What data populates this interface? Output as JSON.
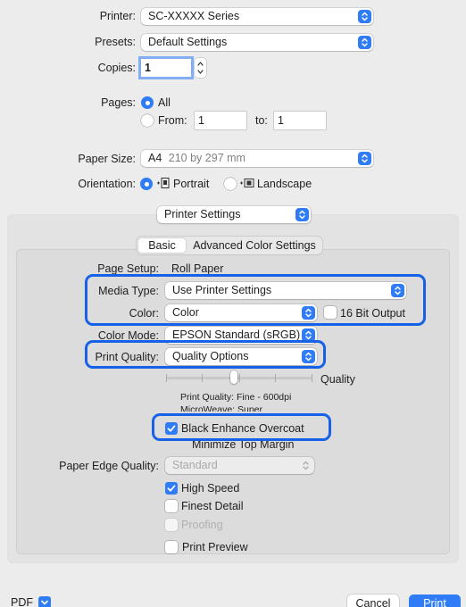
{
  "printer": {
    "label": "Printer:",
    "value": "SC-XXXXX Series"
  },
  "presets": {
    "label": "Presets:",
    "value": "Default Settings"
  },
  "copies": {
    "label": "Copies:",
    "value": "1"
  },
  "pages": {
    "label": "Pages:",
    "all_label": "All",
    "from_label": "From:",
    "from_value": "1",
    "to_label": "to:",
    "to_value": "1"
  },
  "paper_size": {
    "label": "Paper Size:",
    "value": "A4",
    "detail": "210 by 297 mm"
  },
  "orientation": {
    "label": "Orientation:",
    "portrait": "Portrait",
    "landscape": "Landscape"
  },
  "section_popup": {
    "value": "Printer Settings"
  },
  "tabs": {
    "basic": "Basic",
    "advanced": "Advanced Color Settings"
  },
  "settings": {
    "page_setup_label": "Page Setup:",
    "page_setup_value": "Roll Paper",
    "media_type_label": "Media Type:",
    "media_type_value": "Use Printer Settings",
    "color_label": "Color:",
    "color_value": "Color",
    "bit_output_label": "16 Bit Output",
    "color_mode_label": "Color Mode:",
    "color_mode_value": "EPSON Standard (sRGB)",
    "print_quality_label": "Print Quality:",
    "print_quality_value": "Quality Options",
    "quality_slider_label": "Quality",
    "quality_info": "Print Quality: Fine - 600dpi",
    "microweave_info": "MicroWeave: Super",
    "black_enhance_label": "Black Enhance Overcoat",
    "minimize_margin_label": "Minimize Top Margin",
    "paper_edge_label": "Paper Edge Quality:",
    "paper_edge_value": "Standard",
    "high_speed_label": "High Speed",
    "finest_detail_label": "Finest Detail",
    "proofing_label": "Proofing",
    "print_preview_label": "Print Preview"
  },
  "footer": {
    "pdf": "PDF",
    "cancel": "Cancel",
    "print": "Print"
  },
  "colors": {
    "accent": "#2f7cf6",
    "highlight": "#1760e8"
  }
}
